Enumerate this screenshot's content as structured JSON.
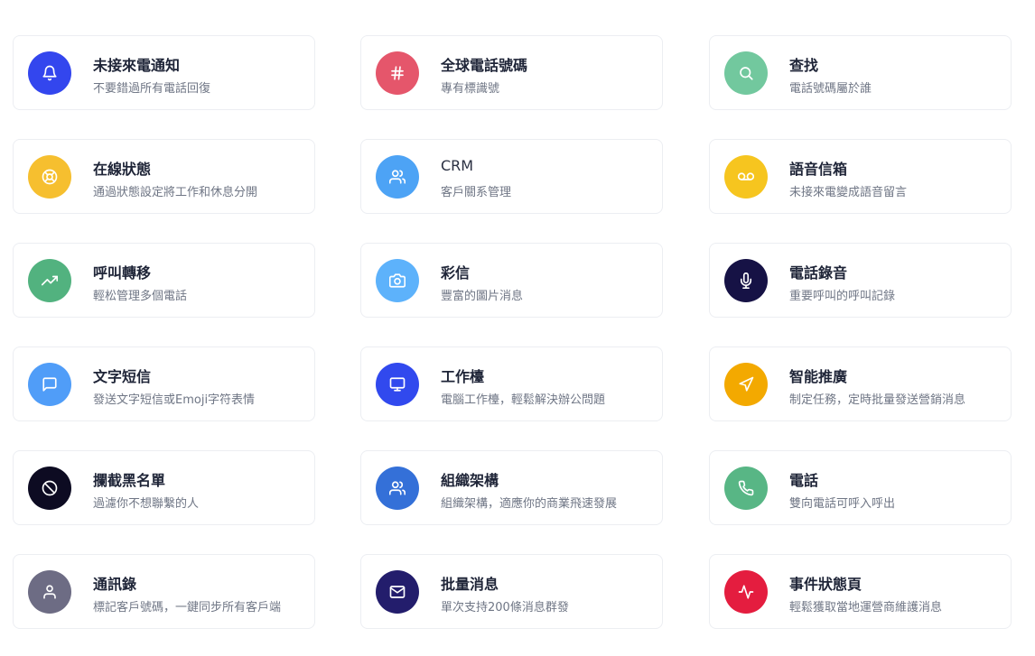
{
  "features": [
    {
      "title": "未接來電通知",
      "desc": "不要錯過所有電話回復",
      "icon": "bell-icon",
      "color": "#3346ee"
    },
    {
      "title": "全球電話號碼",
      "desc": "專有標識號",
      "icon": "hash-icon",
      "color": "#e5566b"
    },
    {
      "title": "查找",
      "desc": "電話號碼屬於誰",
      "icon": "search-icon",
      "color": "#72c89e"
    },
    {
      "title": "在線狀態",
      "desc": "通過狀態設定將工作和休息分開",
      "icon": "lifebuoy-icon",
      "color": "#f6bf2f"
    },
    {
      "title": "CRM",
      "desc": "客戶關系管理",
      "icon": "users-icon",
      "color": "#4da3f5"
    },
    {
      "title": "語音信箱",
      "desc": "未接來電變成語音留言",
      "icon": "voicemail-icon",
      "color": "#f6c51f"
    },
    {
      "title": "呼叫轉移",
      "desc": "輕松管理多個電話",
      "icon": "trending-up-icon",
      "color": "#52b27f"
    },
    {
      "title": "彩信",
      "desc": "豐富的圖片消息",
      "icon": "camera-icon",
      "color": "#5db2fb"
    },
    {
      "title": "電話錄音",
      "desc": "重要呼叫的呼叫記錄",
      "icon": "microphone-icon",
      "color": "#161245"
    },
    {
      "title": "文字短信",
      "desc": "發送文字短信或Emoji字符表情",
      "icon": "message-square-icon",
      "color": "#509df8"
    },
    {
      "title": "工作檯",
      "desc": "電腦工作檯，輕鬆解決辦公問題",
      "icon": "monitor-icon",
      "color": "#3149ee"
    },
    {
      "title": "智能推廣",
      "desc": "制定任務，定時批量發送營銷消息",
      "icon": "navigation-icon",
      "color": "#f3a900"
    },
    {
      "title": "攔截黑名單",
      "desc": "過濾你不想聯繫的人",
      "icon": "block-icon",
      "color": "#0d0b22"
    },
    {
      "title": "組織架構",
      "desc": "組織架構，適應你的商業飛速發展",
      "icon": "users-icon",
      "color": "#3470d8"
    },
    {
      "title": "電話",
      "desc": "雙向電話可呼入呼出",
      "icon": "phone-icon",
      "color": "#58b685"
    },
    {
      "title": "通訊錄",
      "desc": "標記客戶號碼，一鍵同步所有客戶端",
      "icon": "user-icon",
      "color": "#6d6c84"
    },
    {
      "title": "批量消息",
      "desc": "單次支持200條消息群發",
      "icon": "mail-icon",
      "color": "#231d6c"
    },
    {
      "title": "事件狀態頁",
      "desc": "輕鬆獲取當地運營商維護消息",
      "icon": "activity-icon",
      "color": "#e41d3f"
    }
  ]
}
